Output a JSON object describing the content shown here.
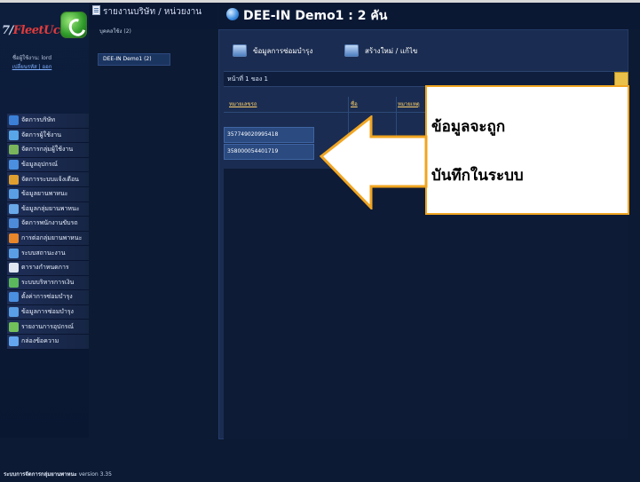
{
  "colors": {
    "background": "#0c1a33",
    "panel": "#1a2c51",
    "accent_orange": "#f0a521",
    "header_text": "#ffd26a"
  },
  "logo": {
    "prefix": "7/",
    "brand": "FleetUcate"
  },
  "user": {
    "line1": "ชื่อผู้ใช้งาน: lord",
    "links": "เปลี่ยนรหัส | ออก"
  },
  "breadcrumb": "รายงานบริษัท / หน่วยงาน",
  "org": {
    "count_label": "บุคคลใช้ง (2)",
    "selected_item": "DEE-IN Demo1 (2)"
  },
  "header": {
    "title": "DEE-IN Demo1 : 2 คัน",
    "icon": "globe-icon"
  },
  "tabs": [
    {
      "label": "ข้อมูลการซ่อมบำรุง",
      "icon": "maintenance-icon"
    },
    {
      "label": "สร้างใหม่ / แก้ไข",
      "icon": "edit-icon"
    }
  ],
  "pagination": {
    "text": "หน้าที่ 1 ของ 1"
  },
  "table": {
    "columns": [
      "หมายเลขรถ",
      "ชื่อ",
      "หมายเหตุ"
    ],
    "rows": [
      [
        "357749020995418"
      ],
      [
        "358000054401719"
      ]
    ]
  },
  "menu": [
    {
      "label": "จัดการบริษัท",
      "icon": "company-icon",
      "color": "#3b7fd6"
    },
    {
      "label": "จัดการผู้ใช้งาน",
      "icon": "user-icon",
      "color": "#58a6e8"
    },
    {
      "label": "จัดการกลุ่มผู้ใช้งาน",
      "icon": "user-group-icon",
      "color": "#7ab55c"
    },
    {
      "label": "ข้อมูลอุปกรณ์",
      "icon": "device-icon",
      "color": "#4a8fe0"
    },
    {
      "label": "จัดการระบบแจ้งเตือน",
      "icon": "alert-icon",
      "color": "#e0a030"
    },
    {
      "label": "ข้อมูลยานพาหนะ",
      "icon": "vehicle-icon",
      "color": "#5a9fe5"
    },
    {
      "label": "ข้อมูลกลุ่มยานพาหนะ",
      "icon": "vehicle-group-icon",
      "color": "#69a9ea"
    },
    {
      "label": "จัดการพนักงานขับรถ",
      "icon": "driver-icon",
      "color": "#4d8bd8"
    },
    {
      "label": "การต่อกลุ่มยานพาหนะ",
      "icon": "link-icon",
      "color": "#e8862a"
    },
    {
      "label": "ระบบสถานะงาน",
      "icon": "status-icon",
      "color": "#5a9fe5"
    },
    {
      "label": "ตารางกำหนดการ",
      "icon": "calendar-icon",
      "color": "#dfe6f2"
    },
    {
      "label": "ระบบบริหารการเงิน",
      "icon": "finance-icon",
      "color": "#5cb85c"
    },
    {
      "label": "ตั้งค่าการซ่อมบำรุง",
      "icon": "settings-icon",
      "color": "#4a8fe0"
    },
    {
      "label": "ข้อมูลการซ่อมบำรุง",
      "icon": "maintenance-icon",
      "color": "#5a9fe5"
    },
    {
      "label": "รายงานการอุปกรณ์",
      "icon": "report-icon",
      "color": "#72c05a"
    },
    {
      "label": "กล่องข้อความ",
      "icon": "message-icon",
      "color": "#63a6ef"
    }
  ],
  "footer": {
    "bold": "ระบบการจัดการกลุ่มยานพาหนะ",
    "version": "version 3.35"
  },
  "callout": {
    "line1": "ข้อมูลจะถูก",
    "line2": "บันทึกในระบบ"
  }
}
